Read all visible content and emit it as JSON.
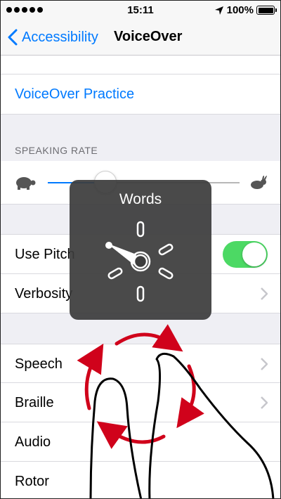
{
  "status_bar": {
    "time": "15:11",
    "battery_text": "100%",
    "battery_level": 1.0,
    "signal_dots": 5,
    "icons": [
      "signal-dots-icon",
      "location-arrow-icon",
      "battery-icon"
    ]
  },
  "nav": {
    "back_label": "Accessibility",
    "title": "VoiceOver",
    "back_icon": "chevron-left-icon",
    "accent_color": "#007aff"
  },
  "practice": {
    "label": "VoiceOver Practice"
  },
  "speaking_rate": {
    "header": "SPEAKING RATE",
    "value": 0.3,
    "min_icon": "turtle-icon",
    "max_icon": "rabbit-icon"
  },
  "settings_group_1": {
    "use_pitch_label": "Use Pitch",
    "use_pitch_on": true,
    "verbosity_label": "Verbosity",
    "toggle_color": "#4cd964"
  },
  "settings_group_2": {
    "items": [
      {
        "label": "Speech",
        "has_chevron": true
      },
      {
        "label": "Braille",
        "has_chevron": true
      },
      {
        "label": "Audio",
        "has_chevron": false
      },
      {
        "label": "Rotor",
        "has_chevron": false
      }
    ]
  },
  "rotor_hud": {
    "title": "Words",
    "icon": "rotor-dial-icon"
  },
  "gesture": {
    "icon": "rotate-gesture-icon",
    "arrow_color": "#d0021b"
  }
}
